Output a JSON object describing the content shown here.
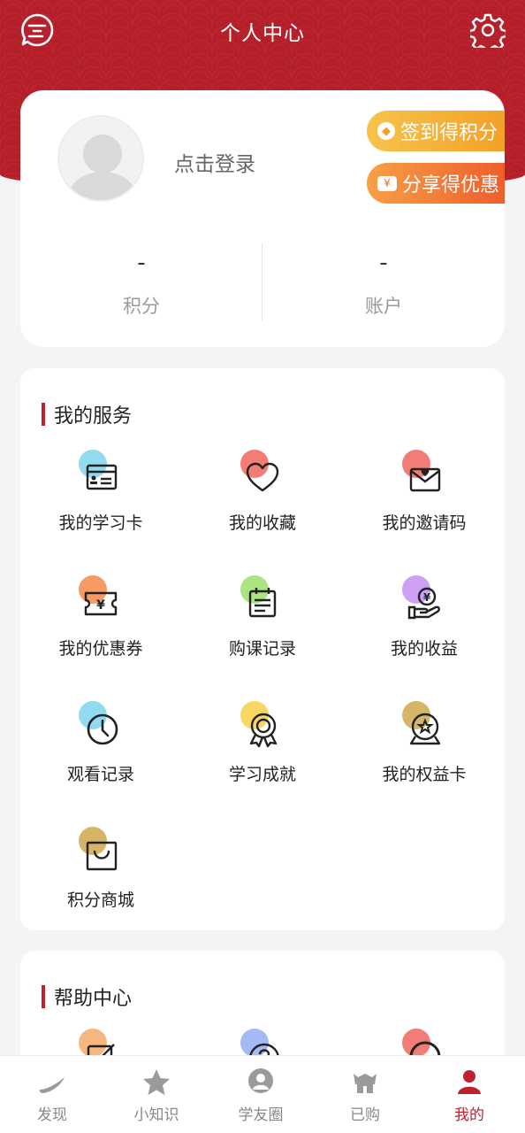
{
  "header": {
    "title": "个人中心",
    "message_icon": "message-icon",
    "settings_icon": "gear-icon",
    "color": "#b51f2a"
  },
  "profile": {
    "login_text": "点击登录",
    "sign_in_label": "签到得积分",
    "share_label": "分享得优惠",
    "stats": [
      {
        "value": "-",
        "label": "积分"
      },
      {
        "value": "-",
        "label": "账户"
      }
    ]
  },
  "services": {
    "title": "我的服务",
    "items": [
      {
        "label": "我的学习卡",
        "icon": "study-card-icon",
        "dot": "#7fd3ec"
      },
      {
        "label": "我的收藏",
        "icon": "heart-icon",
        "dot": "#f0665e"
      },
      {
        "label": "我的邀请码",
        "icon": "invite-envelope-icon",
        "dot": "#f0665e"
      },
      {
        "label": "我的优惠券",
        "icon": "coupon-icon",
        "dot": "#f58a4b"
      },
      {
        "label": "购课记录",
        "icon": "clipboard-icon",
        "dot": "#9be069"
      },
      {
        "label": "我的收益",
        "icon": "earnings-icon",
        "dot": "#c58ef0"
      },
      {
        "label": "观看记录",
        "icon": "clock-icon",
        "dot": "#7fd3ec"
      },
      {
        "label": "学习成就",
        "icon": "medal-icon",
        "dot": "#f6cf48"
      },
      {
        "label": "我的权益卡",
        "icon": "badge-star-icon",
        "dot": "#cfa84c"
      },
      {
        "label": "积分商城",
        "icon": "shopping-bag-icon",
        "dot": "#cfa84c"
      }
    ]
  },
  "help": {
    "title": "帮助中心",
    "dots": [
      "#f5a96a",
      "#93aef0",
      "#f0665e"
    ]
  },
  "tabs": [
    {
      "label": "发现",
      "icon": "discover-icon"
    },
    {
      "label": "小知识",
      "icon": "star-icon"
    },
    {
      "label": "学友圈",
      "icon": "community-icon"
    },
    {
      "label": "已购",
      "icon": "purchased-icon"
    },
    {
      "label": "我的",
      "icon": "user-icon",
      "active": true
    }
  ],
  "accent_color": "#c0202e"
}
